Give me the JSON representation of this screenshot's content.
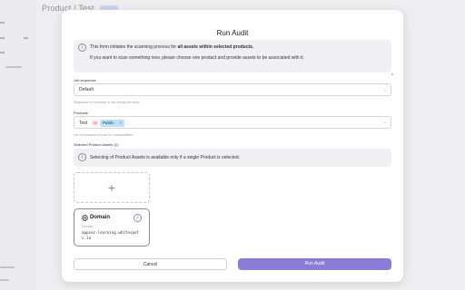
{
  "background": {
    "page_title": "Product / Test"
  },
  "modal": {
    "title": "Run Audit",
    "info": {
      "line1_prefix": "This form initiates the scanning process for ",
      "line1_bold": "all assets within selected products.",
      "line2": "If you want to scan something new, please choose one product and provide assets to be associated with it."
    },
    "job_sequence": {
      "label": "Job sequence",
      "value": "Default",
      "helper": "Sequence of scanners to use during the audit."
    },
    "products": {
      "label": "Products",
      "selected": "Test",
      "count": "50",
      "tag": "Public",
      "tag_remove": "×",
      "helper": "List of products to scan for vulnerabilities."
    },
    "assets": {
      "label": "Selected Product Assets (1)",
      "notice": "Selecting of Product Assets is available only if a single Product is selected.",
      "add_symbol": "+",
      "card": {
        "title": "Domain",
        "sub_label": "Domain",
        "value": "appsec-learning.whitespots.io"
      }
    },
    "buttons": {
      "cancel": "Cancel",
      "run": "Run Audit"
    }
  },
  "colors": {
    "accent": "#8b7cd8",
    "tag_bg": "#bde1f5",
    "count_bg": "#fde7ef"
  }
}
